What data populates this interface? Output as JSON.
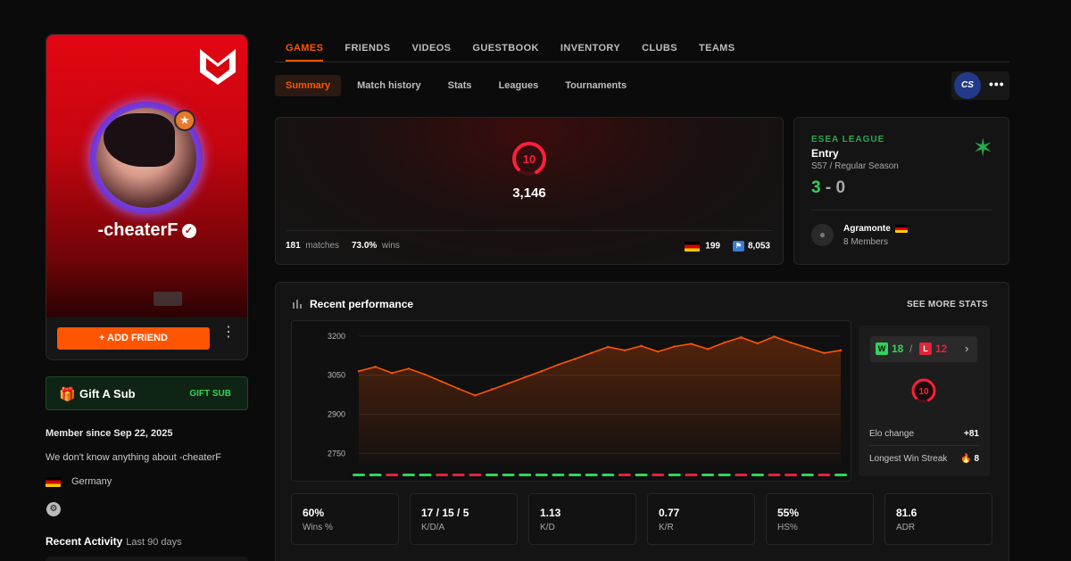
{
  "profile": {
    "nickname": "-cheaterF",
    "verified_icon": "✓",
    "rank_icon": "★",
    "add_friend_label": "ADD FRIEND",
    "add_friend_icon": "+",
    "more_icon": "⋮",
    "member_since": "Member since Sep 22, 2025",
    "about": "We don't know anything about -cheaterF",
    "country": "Germany",
    "recent_activity_label": "Recent Activity",
    "recent_activity_range": "Last 90 days"
  },
  "gift": {
    "label": "Gift A Sub",
    "action": "GIFT SUB",
    "icon": "🎁"
  },
  "main_tabs": [
    {
      "label": "GAMES",
      "active": true
    },
    {
      "label": "FRIENDS"
    },
    {
      "label": "VIDEOS"
    },
    {
      "label": "GUESTBOOK"
    },
    {
      "label": "INVENTORY"
    },
    {
      "label": "CLUBS"
    },
    {
      "label": "TEAMS"
    }
  ],
  "sub_tabs": [
    {
      "label": "Summary",
      "active": true
    },
    {
      "label": "Match history"
    },
    {
      "label": "Stats"
    },
    {
      "label": "Leagues"
    },
    {
      "label": "Tournaments"
    }
  ],
  "game_selector": {
    "game": "CS",
    "menu_icon": "•••"
  },
  "elo": {
    "level": "10",
    "points": "3,146",
    "matches_value": "181",
    "matches_label": "matches",
    "winrate_value": "73.0%",
    "winrate_label": "wins",
    "country_rank": "199",
    "region_rank": "8,053"
  },
  "esea": {
    "league": "ESEA LEAGUE",
    "division": "Entry",
    "season": "S57 / Regular Season",
    "wins": "3",
    "separator": "-",
    "losses": "0",
    "team_name": "Agramonte",
    "team_members": "8 Members"
  },
  "performance": {
    "title": "Recent performance",
    "see_more": "SEE MORE STATS",
    "win_count": "18",
    "win_letter": "W",
    "loss_count": "12",
    "loss_letter": "L",
    "separator": "/",
    "chevron": "›",
    "level": "10",
    "elo_change_label": "Elo change",
    "elo_change_value": "+81",
    "win_streak_label": "Longest Win Streak",
    "win_streak_value": "8",
    "streak_icon": "🔥"
  },
  "stats": [
    {
      "value": "60%",
      "label": "Wins %"
    },
    {
      "value": "17 / 15 / 5",
      "label": "K/D/A"
    },
    {
      "value": "1.13",
      "label": "K/D"
    },
    {
      "value": "0.77",
      "label": "K/R"
    },
    {
      "value": "55%",
      "label": "HS%"
    },
    {
      "value": "81.6",
      "label": "ADR"
    }
  ],
  "colors": {
    "accent": "#ff5500",
    "win": "#32d35a",
    "loss": "#e0243a",
    "esea": "#29a74f"
  },
  "chart_data": {
    "type": "area",
    "y_ticks": [
      3200,
      3050,
      2900,
      2750
    ],
    "ylim": [
      2710,
      3230
    ],
    "values": [
      3065,
      3082,
      3058,
      3075,
      3052,
      3025,
      2998,
      2972,
      2995,
      3018,
      3042,
      3065,
      3090,
      3112,
      3135,
      3158,
      3145,
      3162,
      3140,
      3160,
      3170,
      3150,
      3175,
      3195,
      3172,
      3198,
      3175,
      3155,
      3135,
      3145
    ],
    "results": [
      "W",
      "W",
      "L",
      "W",
      "W",
      "L",
      "L",
      "L",
      "W",
      "W",
      "W",
      "W",
      "W",
      "W",
      "W",
      "W",
      "L",
      "W",
      "L",
      "W",
      "L",
      "W",
      "W",
      "L",
      "W",
      "L",
      "L",
      "W",
      "L",
      "W"
    ]
  }
}
